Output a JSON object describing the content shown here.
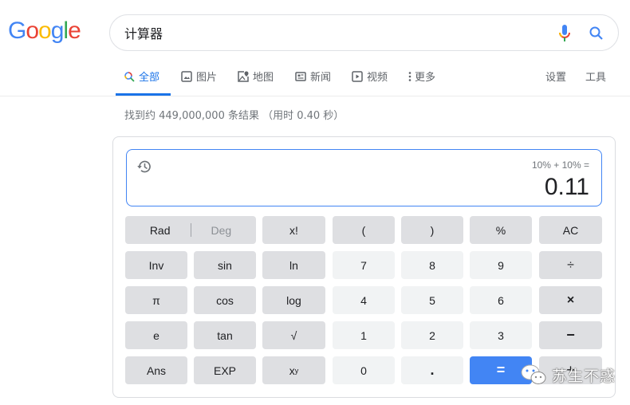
{
  "logo": {
    "letters": [
      "G",
      "o",
      "o",
      "g",
      "l",
      "e"
    ],
    "colors": [
      "#4285f4",
      "#ea4335",
      "#fbbc05",
      "#4285f4",
      "#34a853",
      "#ea4335"
    ]
  },
  "search": {
    "value": "计算器",
    "mic_icon": "mic-icon",
    "search_icon": "search-icon"
  },
  "tabs": [
    {
      "label": "全部",
      "icon": "search-icon",
      "active": true
    },
    {
      "label": "图片",
      "icon": "image-icon",
      "active": false
    },
    {
      "label": "地图",
      "icon": "map-icon",
      "active": false
    },
    {
      "label": "新闻",
      "icon": "news-icon",
      "active": false
    },
    {
      "label": "视频",
      "icon": "video-icon",
      "active": false
    },
    {
      "label": "更多",
      "icon": "more-vert-icon",
      "active": false
    }
  ],
  "tools": {
    "settings": "设置",
    "tools": "工具"
  },
  "result_stats": "找到约 449,000,000 条结果 （用时 0.40 秒）",
  "calculator": {
    "expression": "10% + 10% =",
    "result": "0.11",
    "history_icon": "history-icon",
    "buttons": {
      "rad": "Rad",
      "deg": "Deg",
      "fact": "x!",
      "lparen": "(",
      "rparen": ")",
      "percent": "%",
      "ac": "AC",
      "inv": "Inv",
      "sin": "sin",
      "ln": "ln",
      "n7": "7",
      "n8": "8",
      "n9": "9",
      "divide": "÷",
      "pi": "π",
      "cos": "cos",
      "log": "log",
      "n4": "4",
      "n5": "5",
      "n6": "6",
      "multiply": "×",
      "e": "e",
      "tan": "tan",
      "sqrt": "√",
      "n1": "1",
      "n2": "2",
      "n3": "3",
      "minus": "−",
      "ans": "Ans",
      "exp": "EXP",
      "pow_base": "x",
      "pow_exp": "y",
      "n0": "0",
      "dot": ".",
      "equals": "=",
      "plus": "+"
    },
    "accent_color": "#4285f4"
  },
  "watermark": {
    "text": "苏生不惑",
    "icon": "wechat-icon"
  }
}
